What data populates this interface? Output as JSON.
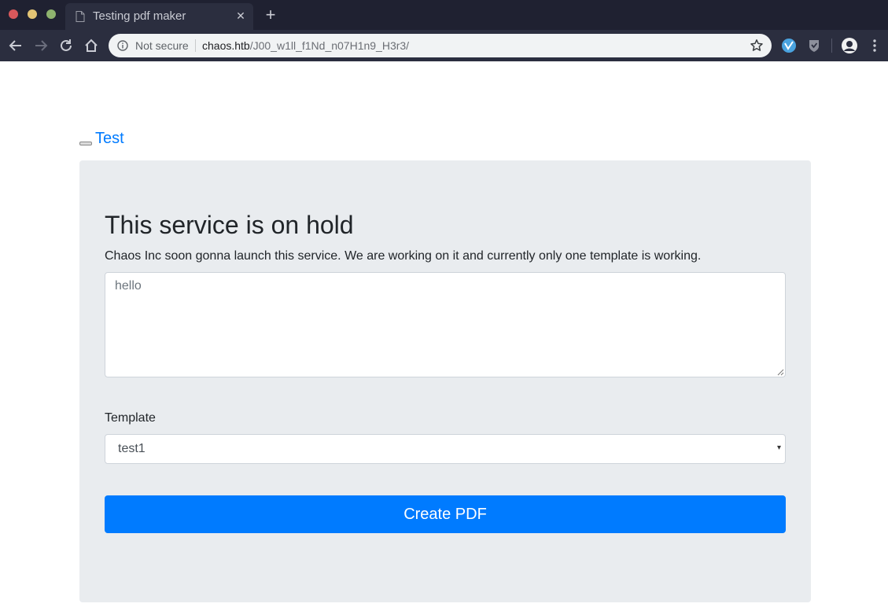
{
  "browser": {
    "tab_title": "Testing pdf maker",
    "new_tab_glyph": "+",
    "close_glyph": "✕",
    "security_label": "Not secure",
    "url_host": "chaos.htb",
    "url_path": "/J00_w1ll_f1Nd_n07H1n9_H3r3/"
  },
  "nav": {
    "brand_link": "Test"
  },
  "main": {
    "heading": "This service is on hold",
    "lead": "Chaos Inc soon gonna launch this service. We are working on it and currently only one template is working.",
    "textarea_placeholder": "hello",
    "template_label": "Template",
    "template_selected": "test1",
    "caret_glyph": "▾",
    "submit_label": "Create PDF"
  },
  "colors": {
    "primary": "#007bff",
    "jumbotron_bg": "#e9ecef",
    "chrome_dark": "#1f2131",
    "toolbar": "#2b2e3f"
  }
}
